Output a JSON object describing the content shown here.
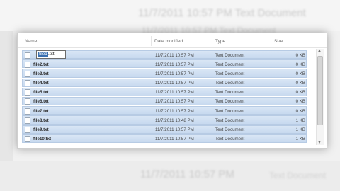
{
  "background": {
    "top_text": "11/7/2011 10:57 PM     Text Document",
    "top_text2": "11/7/2011 10:57 PM     Text Document",
    "bottom_text": "11/7/2011 10:57 PM",
    "bottom_right_text": "Text Document"
  },
  "columns": {
    "name": "Name",
    "date": "Date modified",
    "type": "Type",
    "size": "Size"
  },
  "rename": {
    "selected": "file1",
    "rest": ".txt"
  },
  "files": [
    {
      "name": "file1.txt",
      "date": "11/7/2011 10:57 PM",
      "type": "Text Document",
      "size": "0 KB"
    },
    {
      "name": "file2.txt",
      "date": "11/7/2011 10:57 PM",
      "type": "Text Document",
      "size": "0 KB"
    },
    {
      "name": "file3.txt",
      "date": "11/7/2011 10:57 PM",
      "type": "Text Document",
      "size": "0 KB"
    },
    {
      "name": "file4.txt",
      "date": "11/7/2011 10:57 PM",
      "type": "Text Document",
      "size": "0 KB"
    },
    {
      "name": "file5.txt",
      "date": "11/7/2011 10:57 PM",
      "type": "Text Document",
      "size": "0 KB"
    },
    {
      "name": "file6.txt",
      "date": "11/7/2011 10:57 PM",
      "type": "Text Document",
      "size": "0 KB"
    },
    {
      "name": "file7.txt",
      "date": "11/7/2011 10:57 PM",
      "type": "Text Document",
      "size": "0 KB"
    },
    {
      "name": "file8.txt",
      "date": "11/7/2011 10:48 PM",
      "type": "Text Document",
      "size": "1 KB"
    },
    {
      "name": "file9.txt",
      "date": "11/7/2011 10:57 PM",
      "type": "Text Document",
      "size": "1 KB"
    },
    {
      "name": "file10.txt",
      "date": "11/7/2011 10:57 PM",
      "type": "Text Document",
      "size": "1 KB"
    }
  ],
  "colors": {
    "selection": "#c7d9ef",
    "rename_highlight": "#3a6fb0"
  }
}
